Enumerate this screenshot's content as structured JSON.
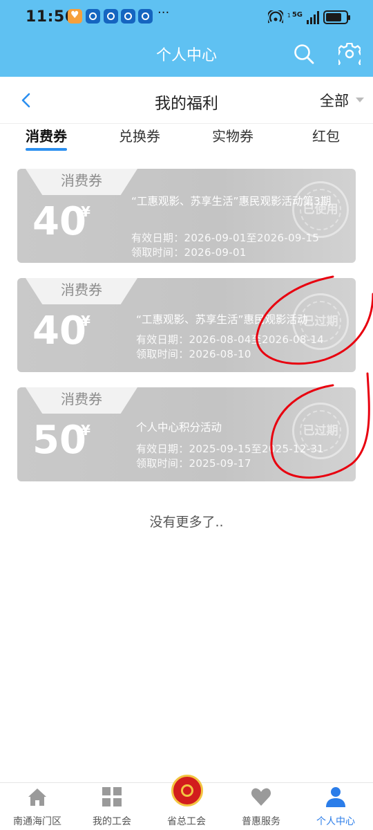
{
  "status_bar": {
    "time": "11:56",
    "network": "5G",
    "sim_index": "1",
    "notification_icons": [
      "heart-app-icon",
      "union-app-icon",
      "union-app-icon",
      "union-app-icon",
      "union-app-icon"
    ],
    "more": "···"
  },
  "header": {
    "title": "个人中心",
    "icons": [
      "search-icon",
      "gear-icon"
    ]
  },
  "subnav": {
    "title": "我的福利",
    "filter_label": "全部"
  },
  "tabs": [
    {
      "label": "消费券",
      "active": true
    },
    {
      "label": "兑换券",
      "active": false
    },
    {
      "label": "实物券",
      "active": false
    },
    {
      "label": "红包",
      "active": false
    }
  ],
  "coupons": [
    {
      "tag": "消费券",
      "amount": "40",
      "currency": "¥",
      "title": "“工惠观影、苏享生活”惠民观影活动第3期",
      "valid": "有效日期：2026-09-01至2026-09-15",
      "received": "领取时间：2026-09-01",
      "stamp": "已使用"
    },
    {
      "tag": "消费券",
      "amount": "40",
      "currency": "¥",
      "title": "“工惠观影、苏享生活”惠民观影活动",
      "valid": "有效日期：2026-08-04至2026-08-14",
      "received": "领取时间：2026-08-10",
      "stamp": "已过期"
    },
    {
      "tag": "消费券",
      "amount": "50",
      "currency": "¥",
      "title": "个人中心积分活动",
      "valid": "有效日期：2025-09-15至2025-12-31",
      "received": "领取时间：2025-09-17",
      "stamp": "已过期"
    }
  ],
  "footer_text": "没有更多了..",
  "bottom_nav": [
    {
      "label": "南通海门区",
      "icon": "home-icon",
      "active": false
    },
    {
      "label": "我的工会",
      "icon": "grid-icon",
      "active": false
    },
    {
      "label": "省总工会",
      "icon": "union-emblem-icon",
      "active": false
    },
    {
      "label": "普惠服务",
      "icon": "heart-icon",
      "active": false
    },
    {
      "label": "个人中心",
      "icon": "person-icon",
      "active": true
    }
  ],
  "colors": {
    "header_bg": "#5fc1f2",
    "accent": "#2b8ff0",
    "coupon_bg": "#c6c6c6",
    "annotation": "#e8000f"
  }
}
